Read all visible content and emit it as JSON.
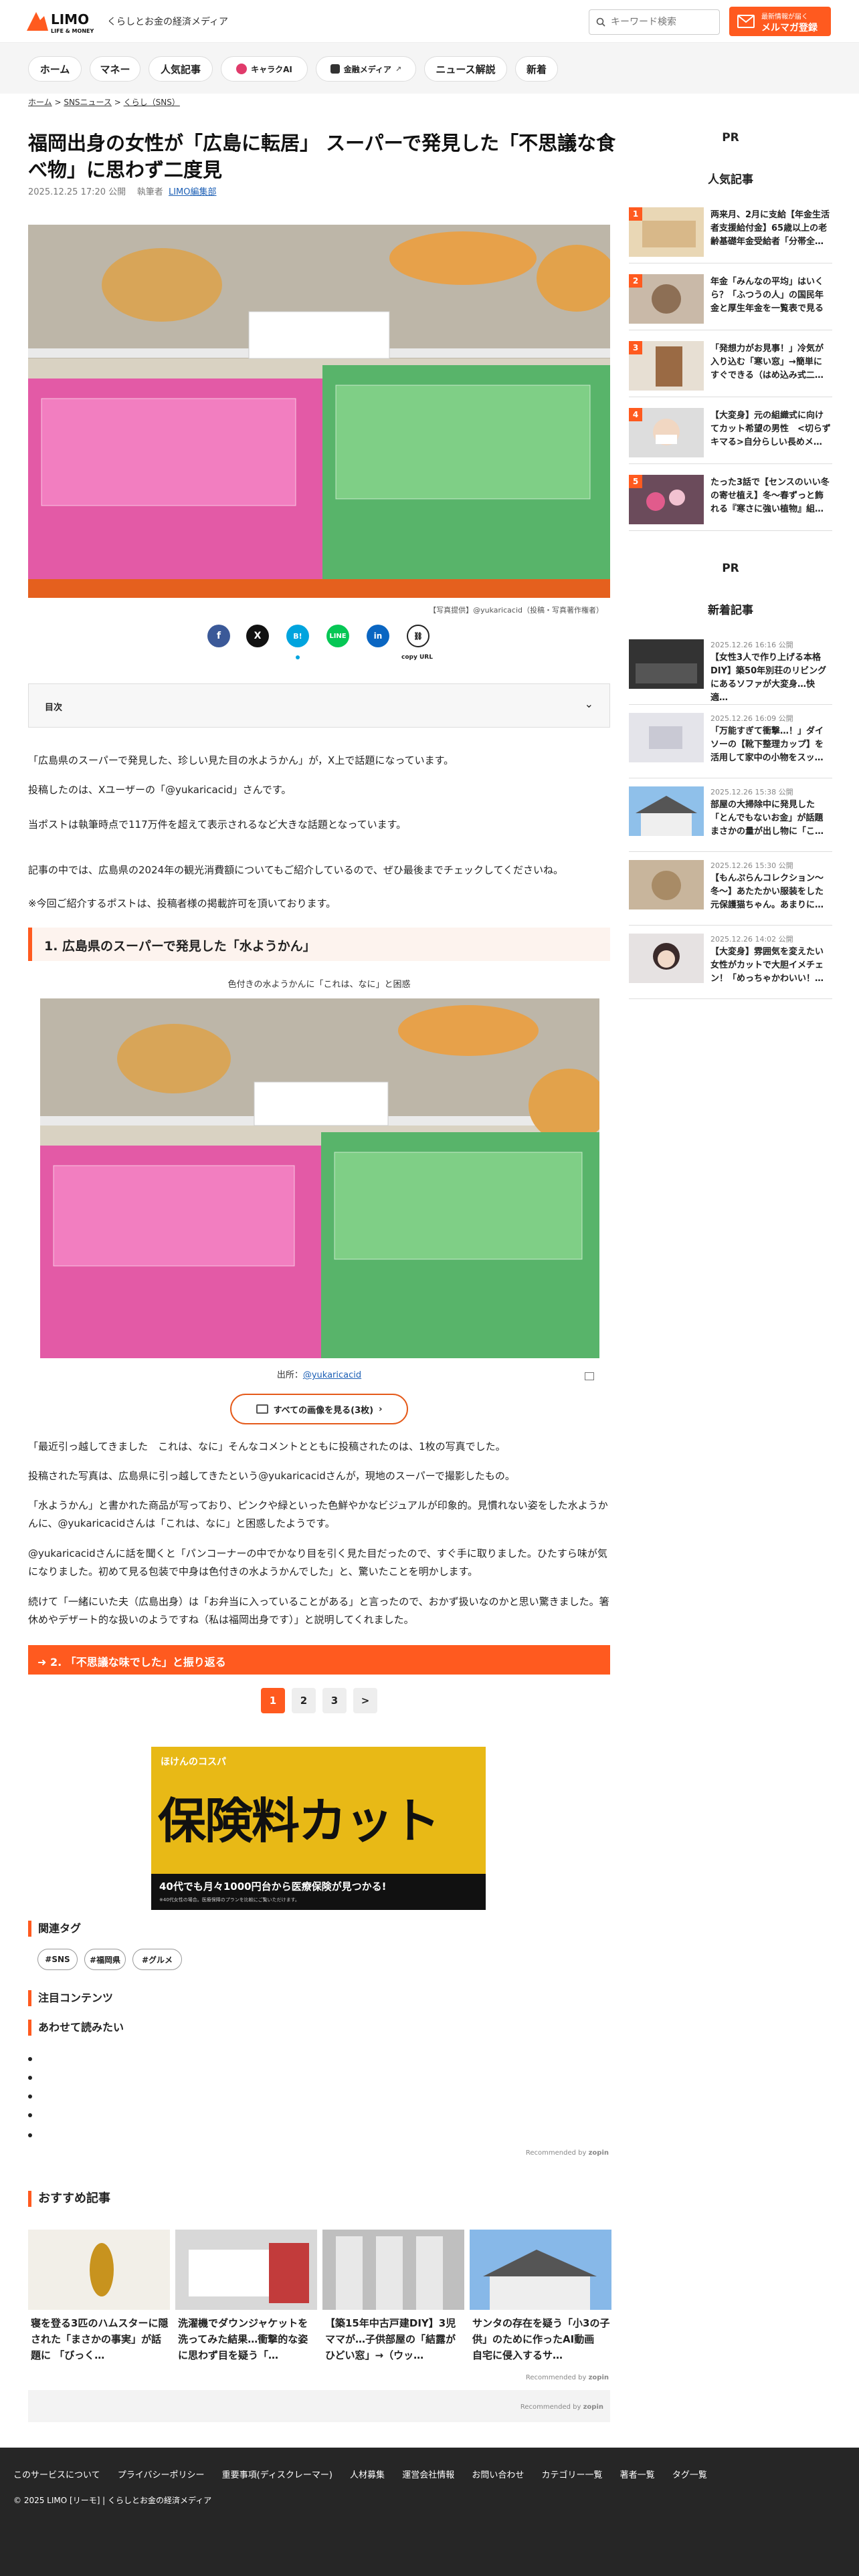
{
  "header": {
    "logo_text": "LIMO",
    "logo_sub": "LIFE & MONEY",
    "tagline": "くらしとお金の経済メディア",
    "search_placeholder": "キーワード検索",
    "magazine_line1": "最新情報が届く",
    "magazine_line2": "メルマガ登録"
  },
  "nav": [
    "ホーム",
    "マネー",
    "人気記事",
    "キャラクAI",
    "金融メディア",
    "ニュース解説",
    "新着"
  ],
  "breadcrumb": [
    "ホーム",
    "SNSニュース",
    "くらし（SNS）"
  ],
  "article": {
    "title": "福岡出身の女性が「広島に転居」 スーパーで発見した「不思議な食べ物」に思わず二度見",
    "date": "2025.12.25 17:20 公開",
    "author_label": "執筆者",
    "author": "LIMO編集部",
    "hero_caption": "【写真提供】@yukaricacid（投稿・写真著作権者）",
    "copy_url": "copy URL",
    "toc_label": "目次",
    "para1": "「広島県のスーパーで発見した、珍しい見た目の水ようかん」が，X上で話題になっています。",
    "para2": "投稿したのは、Xユーザーの「@yukaricacid」さんです。",
    "para3": "当ポストは執筆時点で117万件を超えて表示されるなど大きな話題となっています。",
    "para4": "記事の中では、広島県の2024年の観光消費額についてもご紹介しているので、ぜひ最後までチェックしてくださいね。",
    "para5": "※今回ご紹介するポストは、投稿者様の掲載許可を頂いております。",
    "h2": "1. 広島県のスーパーで発見した「水ようかん」",
    "photo_caption": "色付きの水ようかんに「これは、なに」と困惑",
    "source_label": "出所：",
    "source_link": "@yukaricacid",
    "all_images": "すべての画像を見る(3枚)",
    "para6": "「最近引っ越してきました　これは、なに」そんなコメントとともに投稿されたのは、1枚の写真でした。",
    "para7": "投稿された写真は、広島県に引っ越してきたという@yukaricacidさんが，現地のスーパーで撮影したもの。",
    "para8": "「水ようかん」と書かれた商品が写っており、ピンクや緑といった色鮮やかなビジュアルが印象的。見慣れない姿をした水ようかんに、@yukaricacidさんは「これは、なに」と困惑したようです。",
    "para9": "@yukaricacidさんに話を聞くと「パンコーナーの中でかなり目を引く見た目だったので、すぐ手に取りました。ひたすら味が気になりました。初めて見る包装で中身は色付きの水ようかんでした」と、驚いたことを明かします。",
    "para10": "続けて「一緒にいた夫（広島出身）は「お弁当に入っていることがある」と言ったので、おかず扱いなのかと思い驚きました。箸休めやデザート的な扱いのようですね（私は福岡出身です）」と説明してくれました。",
    "next_section": "2. 「不思議な味でした」と振り返る",
    "pages": [
      "1",
      "2",
      "3",
      ">"
    ]
  },
  "ad": {
    "brand": "ほけんのコスパ",
    "headline": "保険料カット",
    "sub": "40代でも月々1000円台から医療保険が見つかる!",
    "note": "※40代女性の場合。医療保障のプランを比較にご覧いただけます。"
  },
  "tags": {
    "heading": "関連タグ",
    "items": [
      "#SNS",
      "#福岡県",
      "#グルメ"
    ]
  },
  "attention_heading": "注目コンテンツ",
  "also_read_heading": "あわせて読みたい",
  "recommended_by": "Recommended by",
  "zopin": "zopin",
  "recommended": {
    "heading": "おすすめ記事",
    "items": [
      "寝を登る3匹のハムスターに隠された「まさかの事実」が話題に 「びっく…",
      "洗濯機でダウンジャケットを洗ってみた結果…衝撃的な姿に思わず目を疑う「…",
      "【築15年中古戸建DIY】3児ママが…子供部屋の「結露がひどい窓」→（ウッ…",
      "サンタの存在を疑う「小3の子供」のために作ったAI動画　自宅に侵入するサ…"
    ]
  },
  "sidebar": {
    "pr": "PR",
    "popular_heading": "人気記事",
    "popular": [
      {
        "rank": "1",
        "title": "两来月、2月に支給【年金生活者支援給付金】65歳以上の老齢基礎年金受給者「分帯全…"
      },
      {
        "rank": "2",
        "title": "年金「みんなの平均」はいくら？「ふつうの人」の国民年金と厚生年金を一覧表で見る"
      },
      {
        "rank": "3",
        "title": "「発想力がお見事！」冷気が入り込む「寒い窓」→簡単にすぐできる（はめ込み式二…"
      },
      {
        "rank": "4",
        "title": "【大変身】元の組織式に向けてカット希望の男性　<切らずキマる>自分らしい長めメ…"
      },
      {
        "rank": "5",
        "title": "たった3話で【センスのいい冬の寄せ植え】冬〜春ずっと飾れる『寒さに強い植物』組…"
      }
    ],
    "pr2": "PR",
    "new_heading": "新着記事",
    "new": [
      {
        "date": "2025.12.26 16:16 公開",
        "title": "【女性3人で作り上げる本格DIY】築50年別荘のリビングにあるソファが大変身…快適…"
      },
      {
        "date": "2025.12.26 16:09 公開",
        "title": "「万能すぎて衝撃…！」ダイソーの【靴下整理カップ】を活用して家中の小物をスッ…"
      },
      {
        "date": "2025.12.26 15:38 公開",
        "title": "部屋の大掃除中に発見した「とんでもないお金」が話題　まさかの量が出し物に「こ…"
      },
      {
        "date": "2025.12.26 15:30 公開",
        "title": "【もんぷらんコレクション〜冬〜】あたたかい服装をした元保護猫ちゃん。あまりに…"
      },
      {
        "date": "2025.12.26 14:02 公開",
        "title": "【大変身】雰囲気を変えたい女性がカットで大胆イメチェン！「めっちゃかわいい！…"
      }
    ]
  },
  "footer": {
    "links": [
      "このサービスについて",
      "プライバシーポリシー",
      "重要事項(ディスクレーマー)",
      "人材募集",
      "運営会社情報",
      "お問い合わせ",
      "カテゴリー一覧",
      "著者一覧",
      "タグ一覧"
    ],
    "copyright": "© 2025 LIMO [リーモ] | くらしとお金の経済メディア"
  }
}
